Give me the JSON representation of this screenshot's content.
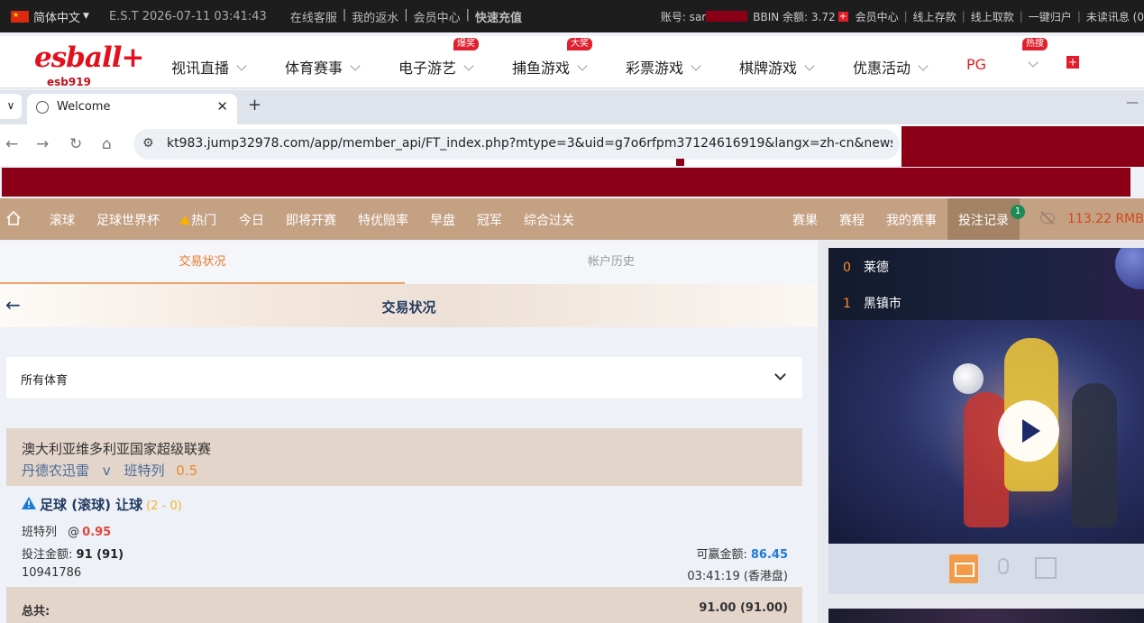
{
  "topbar": {
    "language": "简体中文",
    "est_time": "E.S.T 2026-07-11 03:41:43",
    "links": [
      "在线客服",
      "我的返水",
      "会员中心"
    ],
    "recharge": "快速充值",
    "account_label": "账号: sar",
    "bbin_balance_label": "BBIN 余额: 3.72",
    "right_links": [
      "会员中心",
      "线上存款",
      "线上取款",
      "一键归户",
      "未读讯息 (0"
    ]
  },
  "site": {
    "logo": "esball+",
    "logo_sub": "esb919",
    "nav": [
      {
        "label": "视讯直播",
        "badge": ""
      },
      {
        "label": "体育赛事",
        "badge": ""
      },
      {
        "label": "电子游艺",
        "badge": "爆奖"
      },
      {
        "label": "捕鱼游戏",
        "badge": "大奖"
      },
      {
        "label": "彩票游戏",
        "badge": ""
      },
      {
        "label": "棋牌游戏",
        "badge": ""
      },
      {
        "label": "优惠活动",
        "badge": ""
      }
    ],
    "pg": "PG",
    "hot_badge": "热搜"
  },
  "browser": {
    "tab_title": "Welcome",
    "url": "kt983.jump32978.com/app/member_api/FT_index.php?mtype=3&uid=g7o6rfpm37124616919&langx=zh-cn&news_m..."
  },
  "sportsnav": {
    "items": [
      "滚球",
      "足球世界杯",
      "热门",
      "今日",
      "即将开赛",
      "特优赔率",
      "早盘",
      "冠军",
      "综合过关"
    ],
    "right_items": [
      "赛果",
      "赛程",
      "我的赛事",
      "投注记录"
    ],
    "bets_count": "1",
    "balance": "113.22",
    "currency": "RMB"
  },
  "main": {
    "tabs": [
      "交易状况",
      "帐户历史"
    ],
    "page_title": "交易状况",
    "sport_filter": "所有体育",
    "league": "澳大利亚维多利亚国家超级联赛",
    "home_team": "丹德农迅雷",
    "vs": "v",
    "away_team": "班特列",
    "handicap": "0.5",
    "bet_type": "足球 (滚球) 让球",
    "bet_score": "(2 - 0)",
    "pick_team": "班特列",
    "odds_at": "@",
    "odds": "0.95",
    "stake_label": "投注金额:",
    "stake_value": "91 (91)",
    "win_label": "可赢金额:",
    "win_value": "86.45",
    "bet_id": "10941786",
    "bet_time": "03:41:19 (香港盘)",
    "total_label": "总共:",
    "total_value": "91.00 (91.00)"
  },
  "live": {
    "team1_score": "0",
    "team1": "莱德",
    "team2_score": "1",
    "team2": "黑镇市"
  }
}
